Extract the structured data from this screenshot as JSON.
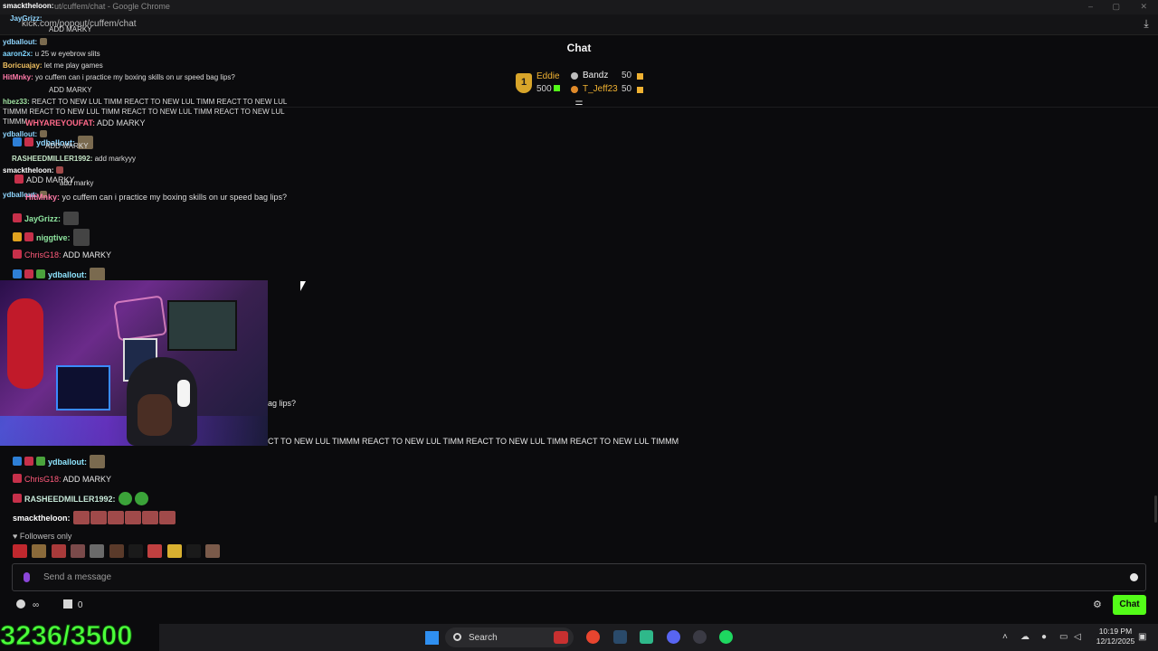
{
  "window": {
    "title": "ut/cuffem/chat - Google Chrome",
    "url": "kick.com/popout/cuffem/chat"
  },
  "chat": {
    "title": "Chat",
    "leaderboard": {
      "rank1": {
        "rank": "1",
        "name": "Eddie",
        "points": "500"
      },
      "rank2": {
        "name": "Bandz",
        "points": "50"
      },
      "rank3": {
        "name": "T_Jeff23",
        "points": "50"
      }
    }
  },
  "ghost_messages": [
    {
      "user": "smacktheloon:",
      "text": ""
    },
    {
      "user": "JayGrizz:",
      "text": ""
    },
    {
      "user": "",
      "text": "ADD MARKY"
    },
    {
      "user": "ydballout:",
      "text": ""
    },
    {
      "user": "aaron2x:",
      "text": "u 25 w eyebrow slits"
    },
    {
      "user": "Boricuajay:",
      "text": "let me play games"
    },
    {
      "user": "HitMnky:",
      "text": "yo cuffem can i practice my boxing skills on ur speed bag lips?"
    },
    {
      "user": "",
      "text": "ADD MARKY"
    },
    {
      "user": "hbez33:",
      "text": "REACT TO NEW LUL TIMM REACT TO NEW LUL TIMM REACT TO NEW LUL"
    },
    {
      "user": "",
      "text": "TIMMM REACT TO NEW LUL TIMM REACT TO NEW LUL TIMM REACT TO NEW LUL"
    },
    {
      "user": "",
      "text": "TIMMM"
    },
    {
      "user": "WHYAREYOUFAT:",
      "text": "ADD MARKY"
    },
    {
      "user": "ydballout:",
      "text": ""
    },
    {
      "user": "ydballout:",
      "text": ""
    },
    {
      "user": "",
      "text": "ADD MARKY"
    },
    {
      "user": "RASHEEDMILLER1992:",
      "text": "add markyyy"
    },
    {
      "user": "smacktheloon:",
      "text": ""
    },
    {
      "user": "",
      "text": "ADD MARKY"
    },
    {
      "user": "ydballout:",
      "text": ""
    },
    {
      "user": "",
      "text": "add marky"
    },
    {
      "user": "HitMnky:",
      "text": "yo cuffem can i practice my boxing skills on ur speed bag lips?"
    }
  ],
  "messages": [
    {
      "user": "JayGrizz:",
      "text": ""
    },
    {
      "user": "niggtive:",
      "text": ""
    },
    {
      "user": "ChrisG18:",
      "text": "ADD MARKY"
    },
    {
      "user": "ydballout:",
      "text": ""
    },
    {
      "user": "",
      "text": "ag lips?"
    },
    {
      "user": "",
      "text": "CT TO NEW LUL TIMMM REACT TO NEW LUL TIMM REACT TO NEW LUL TIMM REACT TO NEW LUL TIMMM"
    },
    {
      "user": "ydballout:",
      "text": ""
    },
    {
      "user": "ChrisG18:",
      "text": "ADD MARKY"
    },
    {
      "user": "RASHEEDMILLER1992:",
      "text": ""
    },
    {
      "user": "smacktheloon:",
      "text": ""
    }
  ],
  "followers_only": "Followers only",
  "input": {
    "placeholder": "Send a message"
  },
  "footer": {
    "infinity": "∞",
    "count": "0",
    "chat_button": "Chat"
  },
  "counter_overlay": "3236/3500",
  "taskbar": {
    "search_label": "Search",
    "time": "10:19 PM",
    "date": "12/12/2025"
  },
  "colors": {
    "accent_green": "#53fc18",
    "medal_gold": "#d8a52a"
  }
}
